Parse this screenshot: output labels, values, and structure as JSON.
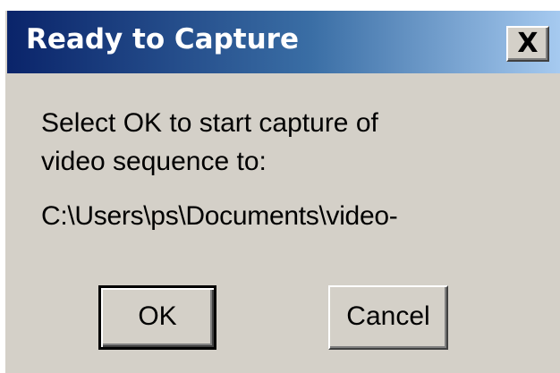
{
  "dialog": {
    "title": "Ready to Capture",
    "close_label": "X",
    "message_line1": "Select OK to start capture of",
    "message_line2": "video sequence to:",
    "path": "C:\\Users\\ps\\Documents\\video-",
    "ok_label": "OK",
    "cancel_label": "Cancel"
  },
  "colors": {
    "titlebar_start": "#0a246a",
    "titlebar_end": "#a6caf0",
    "face": "#d4d0c8"
  }
}
